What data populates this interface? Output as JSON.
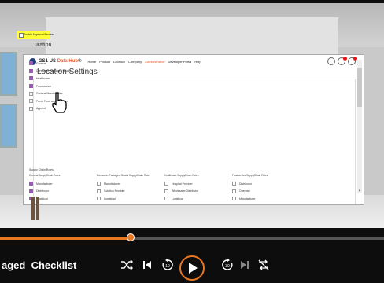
{
  "nav": {
    "brand_prefix": "GS1 US ",
    "brand_highlight": "Data Hub",
    "brand_suffix": "®",
    "items": [
      "Home",
      "Product",
      "Location",
      "Company",
      "Administration",
      "Developer Portal",
      "Help"
    ],
    "active": "Administration"
  },
  "page": {
    "title": "Location Settings",
    "approval_label": "Enable Approval Process",
    "section_title_visible": "uration"
  },
  "industries": [
    {
      "label": "General",
      "checked": true
    },
    {
      "label": "Consumer Packaged Goods",
      "checked": true
    },
    {
      "label": "Healthcare",
      "checked": true
    },
    {
      "label": "Foodservice",
      "checked": true
    },
    {
      "label": "General Merchandise",
      "checked": false
    },
    {
      "label": "Fresh Food and Upstream",
      "checked": false
    },
    {
      "label": "Apparel",
      "checked": false
    }
  ],
  "supply_chain": {
    "heading": "Supply Chain Roles",
    "columns": [
      {
        "title": "General SupplyChain Roles",
        "items": [
          {
            "label": "Manufacturer",
            "checked": true
          },
          {
            "label": "Distributor",
            "checked": true
          },
          {
            "label": "Logistical",
            "checked": true
          }
        ]
      },
      {
        "title": "Consumer Packaged Goods SupplyChain Roles",
        "items": [
          {
            "label": "Manufacturer",
            "checked": false
          },
          {
            "label": "Solution Provider",
            "checked": false
          },
          {
            "label": "Logistical",
            "checked": false
          }
        ]
      },
      {
        "title": "Healthcare SupplyChain Roles",
        "items": [
          {
            "label": "Hospital Provider",
            "checked": false
          },
          {
            "label": "Wholesaler/Distributor",
            "checked": false
          },
          {
            "label": "Logistical",
            "checked": false
          }
        ]
      },
      {
        "title": "Foodservice SupplyChain Roles",
        "items": [
          {
            "label": "Distributor",
            "checked": false
          },
          {
            "label": "Operator",
            "checked": false
          },
          {
            "label": "Manufacturer",
            "checked": false
          }
        ]
      }
    ]
  },
  "player": {
    "title": "aged_Checklist",
    "progress_fraction": 0.34,
    "controls": [
      "shuffle-icon",
      "previous-icon",
      "rewind-10-icon",
      "play-icon",
      "forward-30-icon",
      "next-icon",
      "repeat-off-icon"
    ]
  },
  "colors": {
    "accent": "#e87722",
    "brand_highlight": "#f26334",
    "checked": "#9b59b6",
    "highlight": "#ffff33"
  }
}
